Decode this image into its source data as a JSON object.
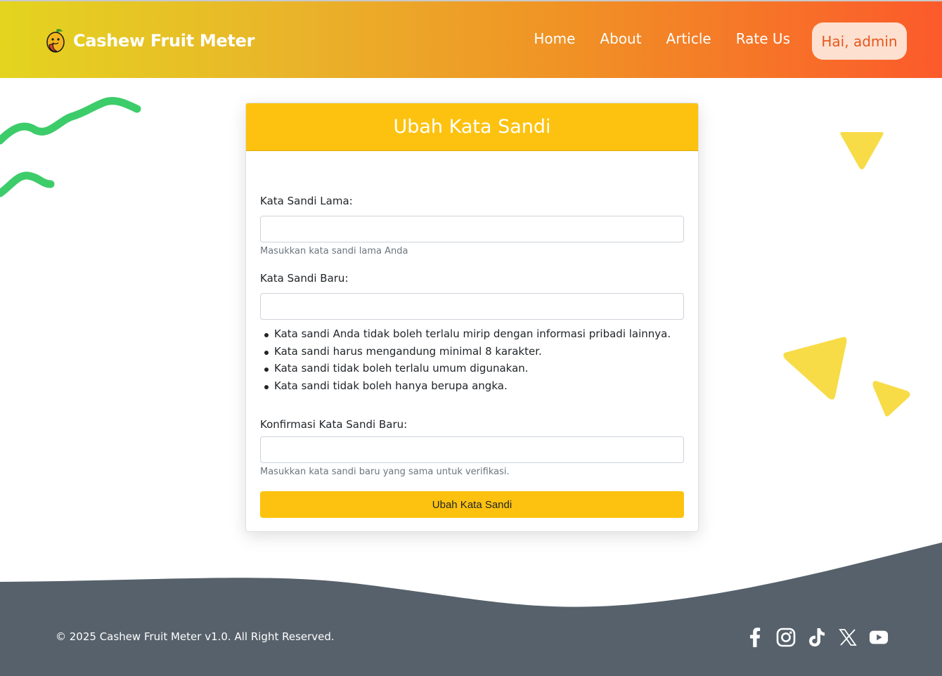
{
  "header": {
    "brand": "Cashew Fruit Meter",
    "nav": [
      "Home",
      "About",
      "Article",
      "Rate Us"
    ],
    "user_button": "Hai, admin"
  },
  "form": {
    "title": "Ubah Kata Sandi",
    "old_password": {
      "label": "Kata Sandi Lama:",
      "value": "",
      "help": "Masukkan kata sandi lama Anda"
    },
    "new_password": {
      "label": "Kata Sandi Baru:",
      "value": "",
      "rules": [
        "Kata sandi Anda tidak boleh terlalu mirip dengan informasi pribadi lainnya.",
        "Kata sandi harus mengandung minimal 8 karakter.",
        "Kata sandi tidak boleh terlalu umum digunakan.",
        "Kata sandi tidak boleh hanya berupa angka."
      ]
    },
    "confirm_password": {
      "label": "Konfirmasi Kata Sandi Baru:",
      "value": "",
      "help": "Masukkan kata sandi baru yang sama untuk verifikasi."
    },
    "submit": "Ubah Kata Sandi"
  },
  "footer": {
    "copyright": "© 2025 Cashew Fruit Meter v1.0. All Right Reserved.",
    "socials": [
      "facebook-icon",
      "instagram-icon",
      "tiktok-icon",
      "x-icon",
      "youtube-icon"
    ]
  },
  "colors": {
    "accent": "#fdc20f",
    "footer": "#56616b",
    "header_start": "#e4d41f",
    "header_end": "#fc5a2b",
    "wave_green": "#3dcc6a",
    "triangle_yellow": "#f7dc48"
  }
}
